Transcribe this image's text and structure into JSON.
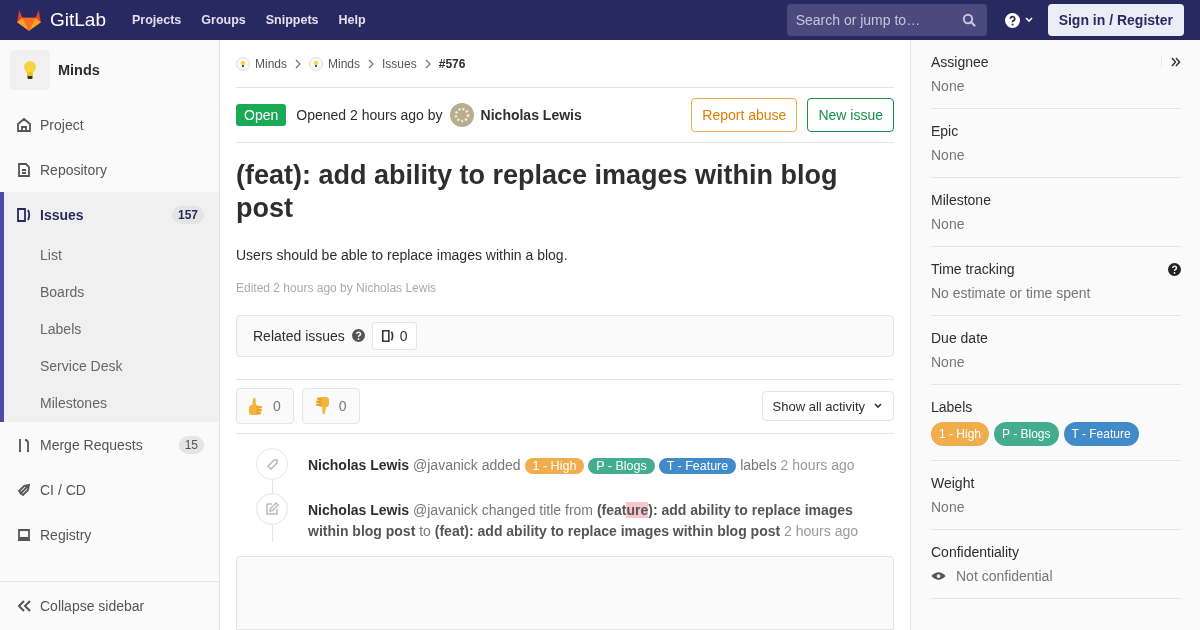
{
  "topbar": {
    "brand": "GitLab",
    "links": [
      "Projects",
      "Groups",
      "Snippets",
      "Help"
    ],
    "search": {
      "placeholder": "Search or jump to…"
    },
    "sign_in": "Sign in / Register"
  },
  "sidebar": {
    "project": "Minds",
    "items": [
      {
        "label": "Project",
        "selected": false
      },
      {
        "label": "Repository",
        "selected": false
      },
      {
        "label": "Issues",
        "selected": true,
        "count": "157",
        "children": [
          {
            "label": "List"
          },
          {
            "label": "Boards"
          },
          {
            "label": "Labels"
          },
          {
            "label": "Service Desk"
          },
          {
            "label": "Milestones"
          }
        ]
      },
      {
        "label": "Merge Requests",
        "selected": false,
        "count": "15"
      },
      {
        "label": "CI / CD",
        "selected": false
      },
      {
        "label": "Registry",
        "selected": false
      }
    ],
    "collapse": "Collapse sidebar"
  },
  "breadcrumbs": [
    {
      "label": "Minds",
      "kind": "project"
    },
    {
      "label": "Minds",
      "kind": "project"
    },
    {
      "label": "Issues",
      "kind": "link"
    },
    {
      "label": "#576",
      "kind": "current"
    }
  ],
  "issue": {
    "status": "Open",
    "opened": "Opened 2 hours ago by",
    "author": "Nicholas Lewis",
    "actions": [
      {
        "label": "Report abuse",
        "kind": "warning"
      },
      {
        "label": "New issue",
        "kind": "success"
      }
    ],
    "title": "(feat): add ability to replace images within blog post",
    "description": "Users should be able to replace images within a blog.",
    "edited": "Edited 2 hours ago by Nicholas Lewis",
    "related": {
      "label": "Related issues",
      "count": "0"
    },
    "reactions": [
      {
        "kind": "thumbsup",
        "count": "0"
      },
      {
        "kind": "thumbsdown",
        "count": "0"
      }
    ],
    "activity_filter": "Show all activity",
    "notes": [
      {
        "kind": "label",
        "segments": [
          {
            "kind": "author",
            "text": "Nicholas Lewis"
          },
          {
            "kind": "plain",
            "text": "@javanick added"
          },
          {
            "kind": "label",
            "text": "1 - High",
            "color": "#f0ad4e"
          },
          {
            "kind": "label",
            "text": "P - Blogs",
            "color": "#44ad8e"
          },
          {
            "kind": "label",
            "text": "T - Feature",
            "color": "#428bca"
          },
          {
            "kind": "plain",
            "text": "labels"
          },
          {
            "kind": "time",
            "text": "2 hours ago"
          }
        ]
      },
      {
        "kind": "edit",
        "segments": [
          {
            "kind": "author",
            "text": "Nicholas Lewis"
          },
          {
            "kind": "plain",
            "text": "@javanick changed title from"
          },
          {
            "kind": "bold",
            "text": "(feat"
          },
          {
            "kind": "deleted",
            "text": "ure"
          },
          {
            "kind": "bold",
            "text": "): add ability to replace images within blog post"
          },
          {
            "kind": "plain",
            "text": "to"
          },
          {
            "kind": "bold",
            "text": "(feat): add ability to replace images within blog post"
          },
          {
            "kind": "time",
            "text": "2 hours ago"
          }
        ]
      }
    ]
  },
  "right_sidebar": {
    "blocks": [
      {
        "title": "Assignee",
        "value": "None",
        "kind": "text"
      },
      {
        "title": "Epic",
        "value": "None",
        "kind": "text"
      },
      {
        "title": "Milestone",
        "value": "None",
        "kind": "text"
      },
      {
        "title": "Time tracking",
        "value": "No estimate or time spent",
        "kind": "help"
      },
      {
        "title": "Due date",
        "value": "None",
        "kind": "text"
      },
      {
        "title": "Labels",
        "kind": "labels",
        "labels": [
          {
            "text": "1 - High",
            "color": "#f0ad4e"
          },
          {
            "text": "P - Blogs",
            "color": "#44ad8e"
          },
          {
            "text": "T - Feature",
            "color": "#428bca"
          }
        ]
      },
      {
        "title": "Weight",
        "value": "None",
        "kind": "text"
      },
      {
        "title": "Confidentiality",
        "value": "Not confidential",
        "kind": "eye"
      }
    ]
  }
}
